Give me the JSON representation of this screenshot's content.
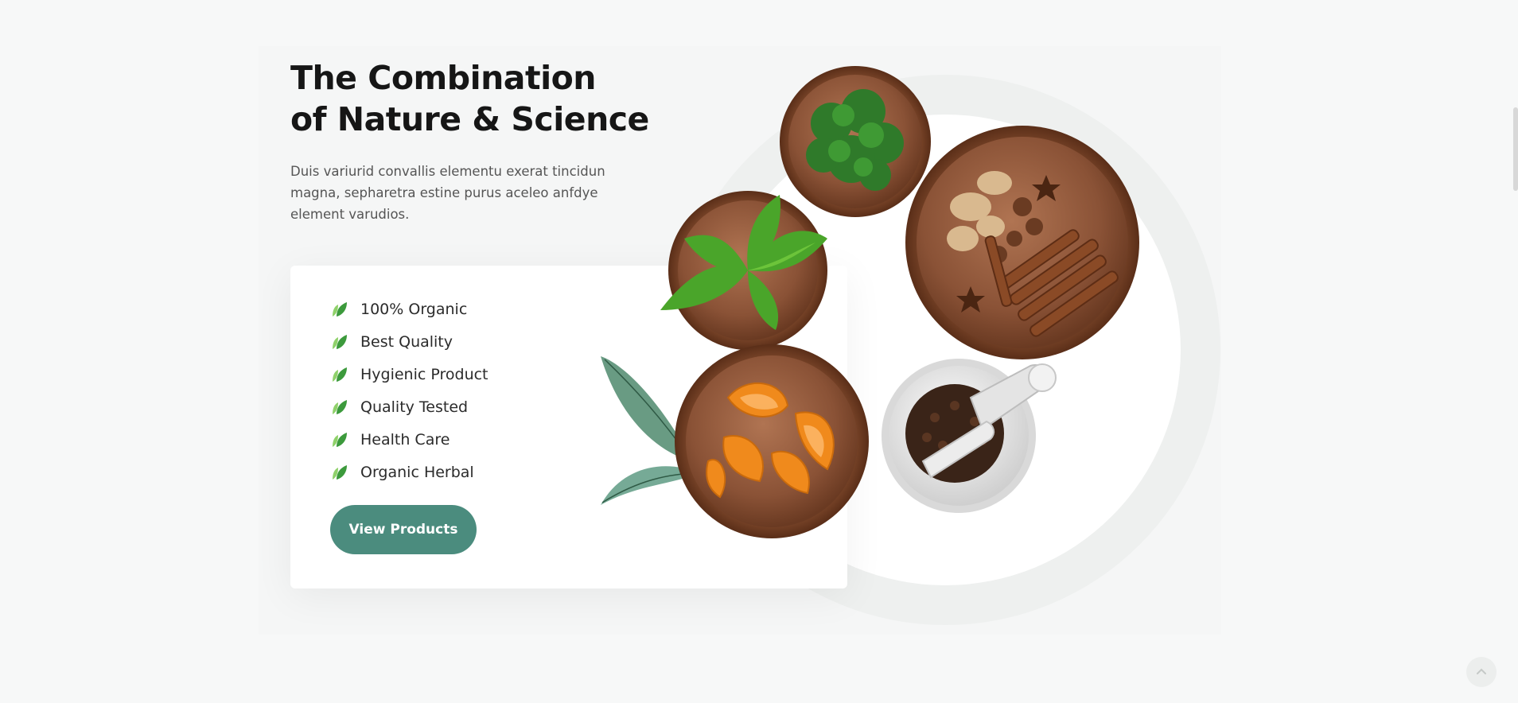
{
  "heading": {
    "line1": "The Combination",
    "line2": "of Nature & Science"
  },
  "description": "Duis variurid convallis elementu exerat tincidun magna, sepharetra estine purus aceleo anfdye element varudios.",
  "features": [
    {
      "label": "100% Organic",
      "icon": "leaf-icon"
    },
    {
      "label": "Best Quality",
      "icon": "leaf-icon"
    },
    {
      "label": "Hygienic Product",
      "icon": "leaf-icon"
    },
    {
      "label": "Quality Tested",
      "icon": "leaf-icon"
    },
    {
      "label": "Health Care",
      "icon": "leaf-icon"
    },
    {
      "label": "Organic Herbal",
      "icon": "leaf-icon"
    }
  ],
  "cta": {
    "label": "View Products"
  },
  "colors": {
    "accent": "#4b8c7e",
    "leaf_light": "#8fd16a",
    "leaf_dark": "#3c9a3c"
  },
  "scroll_to_top": {
    "icon": "chevron-up-icon"
  }
}
